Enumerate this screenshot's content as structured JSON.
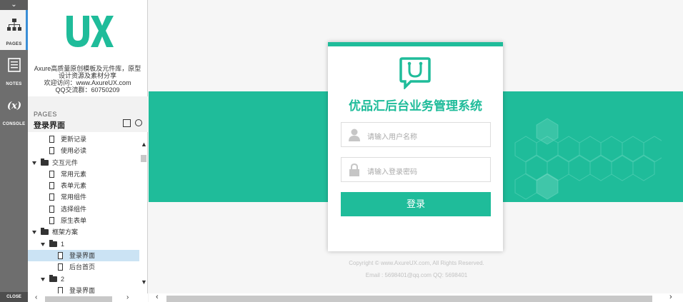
{
  "rail": {
    "pages_label": "PAGES",
    "notes_label": "NOTES",
    "console_label": "CONSOLE",
    "close_label": "CLOSE"
  },
  "brand": {
    "logo_text": "UX",
    "line1": "Axure高质量原创模板及元件库，原型",
    "line2": "设计资源及素材分享",
    "line3": "欢迎访问：www.AxureUX.com",
    "line4": "QQ交流群：60750209"
  },
  "pages": {
    "caption": "PAGES",
    "current": "登录界面"
  },
  "tree": [
    {
      "label": "更新记录",
      "type": "page",
      "level": 2
    },
    {
      "label": "使用必读",
      "type": "page",
      "level": 2
    },
    {
      "label": "交互元件",
      "type": "folder",
      "level": 1
    },
    {
      "label": "常用元素",
      "type": "page",
      "level": 2
    },
    {
      "label": "表单元素",
      "type": "page",
      "level": 2
    },
    {
      "label": "常用组件",
      "type": "page",
      "level": 2
    },
    {
      "label": "选择组件",
      "type": "page",
      "level": 2
    },
    {
      "label": "原生表单",
      "type": "page",
      "level": 2
    },
    {
      "label": "框架方案",
      "type": "folder",
      "level": 1
    },
    {
      "label": "1",
      "type": "folder",
      "level": 2
    },
    {
      "label": "登录界面",
      "type": "page",
      "level": 3,
      "selected": true
    },
    {
      "label": "后台首页",
      "type": "page",
      "level": 3
    },
    {
      "label": "2",
      "type": "folder",
      "level": 2
    },
    {
      "label": "登录界面",
      "type": "page",
      "level": 3
    }
  ],
  "login": {
    "title": "优品汇后台业务管理系统",
    "username_placeholder": "请输入用户名称",
    "password_placeholder": "请输入登录密码",
    "submit_label": "登录",
    "copyright": "Copyright © www.AxureUX.com, All Rights Reserved.",
    "contact": "Email : 5698401@qq.com  QQ: 5698401"
  },
  "colors": {
    "accent": "#1fbc9a",
    "rail": "#6e6e6e"
  }
}
